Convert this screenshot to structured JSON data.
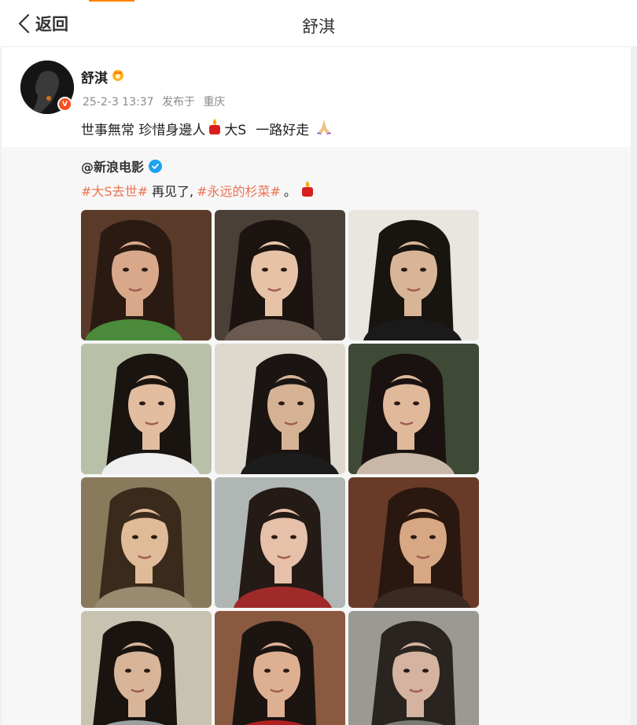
{
  "header": {
    "back_label": "返回",
    "title": "舒淇"
  },
  "post": {
    "username": "舒淇",
    "timestamp": "25-2-3 13:37",
    "location_prefix": "发布于",
    "location": "重庆",
    "text_part1": "世事無常 珍惜身邊人",
    "text_part2": "大S",
    "text_part3": "一路好走",
    "emojis": [
      "candle-emoji",
      "pray-emoji"
    ]
  },
  "repost": {
    "author": "@新浪电影",
    "tag1": "#大S去世#",
    "text_middle": "再见了,",
    "tag2": "#永远的杉菜#",
    "text_end": "。",
    "photos": [
      {
        "bg": "#5a3b2a",
        "skin": "#d9a88a",
        "hair": "#2a1a12",
        "cloth": "#4a8a3a"
      },
      {
        "bg": "#4a4038",
        "skin": "#e6c2a6",
        "hair": "#1c1410",
        "cloth": "#6a5a50"
      },
      {
        "bg": "#e8e6df",
        "skin": "#d8b596",
        "hair": "#181410",
        "cloth": "#1a1a1a"
      },
      {
        "bg": "#b9c0a8",
        "skin": "#e2bda0",
        "hair": "#1a1410",
        "cloth": "#efefef"
      },
      {
        "bg": "#ddd9cc",
        "skin": "#d6b294",
        "hair": "#1a1512",
        "cloth": "#1c1c1c"
      },
      {
        "bg": "#3e4a36",
        "skin": "#e0b89a",
        "hair": "#1a1210",
        "cloth": "#c9b7a8"
      },
      {
        "bg": "#8a7a5c",
        "skin": "#e0bb98",
        "hair": "#3a2a1c",
        "cloth": "#9a8a70"
      },
      {
        "bg": "#b0b6b4",
        "skin": "#e6c0a8",
        "hair": "#241a16",
        "cloth": "#a02a2a"
      },
      {
        "bg": "#6a3a28",
        "skin": "#d8a884",
        "hair": "#2a1810",
        "cloth": "#3a2a20"
      },
      {
        "bg": "#c8c2b0",
        "skin": "#d8b498",
        "hair": "#1a1410",
        "cloth": "#9aa0a0"
      },
      {
        "bg": "#8a5a40",
        "skin": "#deb092",
        "hair": "#1c1410",
        "cloth": "#b02020"
      },
      {
        "bg": "#9a9a92",
        "skin": "#d4b4a0",
        "hair": "#2a2420",
        "cloth": "#7a7a74"
      }
    ]
  }
}
